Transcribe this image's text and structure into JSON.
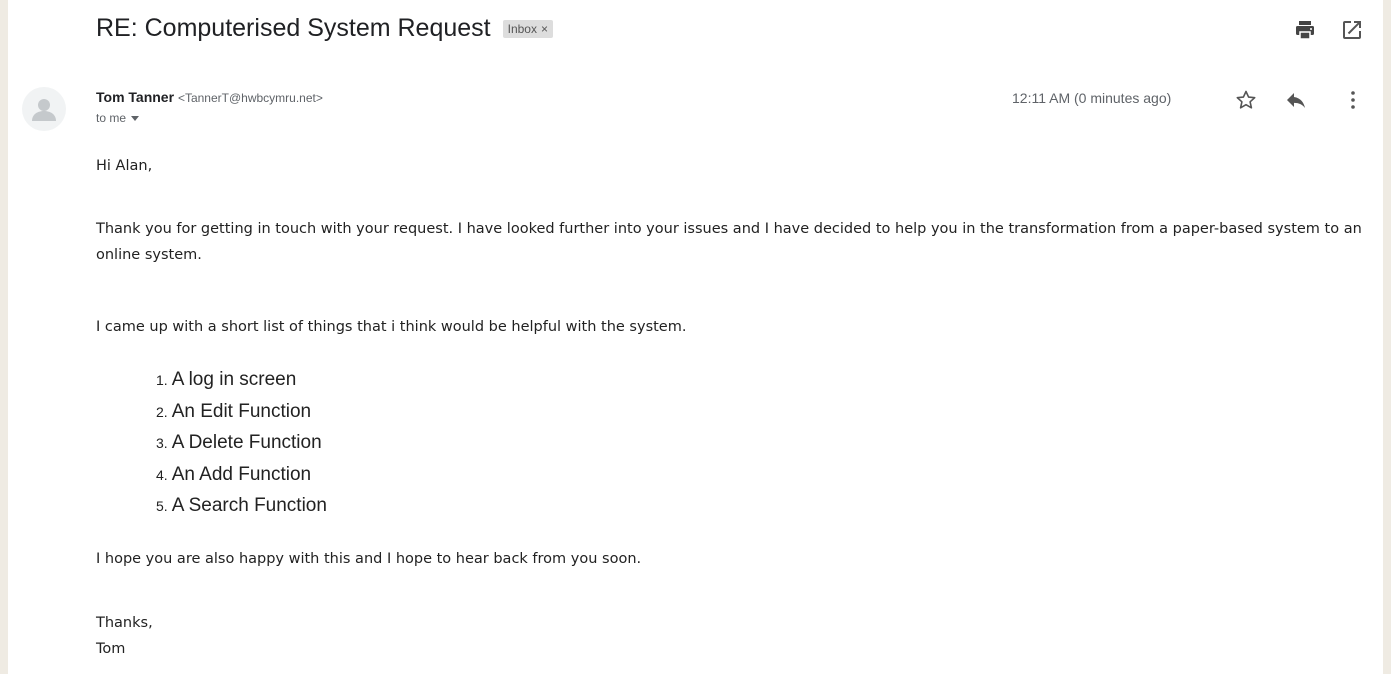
{
  "email": {
    "subject": "RE: Computerised System Request",
    "label": "Inbox",
    "label_close": "×",
    "sender_name": "Tom Tanner",
    "sender_email": "<TannerT@hwbcymru.net>",
    "recipient": "to me",
    "time": "12:11 AM (0 minutes ago)",
    "greeting": "Hi Alan,",
    "para1": "Thank you for getting in touch with your request. I have looked further into your issues and I have decided to help you in the transformation from a paper-based system to an online system.",
    "para2": "I came up with a short list of things that i think would be helpful with the system.",
    "items": [
      {
        "num": "1.",
        "text": "A log in screen"
      },
      {
        "num": "2.",
        "text": "An Edit Function"
      },
      {
        "num": "3.",
        "text": "A Delete Function"
      },
      {
        "num": "4.",
        "text": "An Add Function"
      },
      {
        "num": "5.",
        "text": "A Search Function"
      }
    ],
    "para3": "I hope you are also happy with this and I hope to hear back from you soon.",
    "signoff": "Thanks,",
    "signature": "Tom"
  },
  "icons": {
    "print": "print-icon",
    "open_new": "open-in-new-window-icon",
    "star": "star-icon",
    "reply": "reply-icon",
    "more": "more-vertical-icon",
    "avatar": "default-avatar-icon"
  }
}
